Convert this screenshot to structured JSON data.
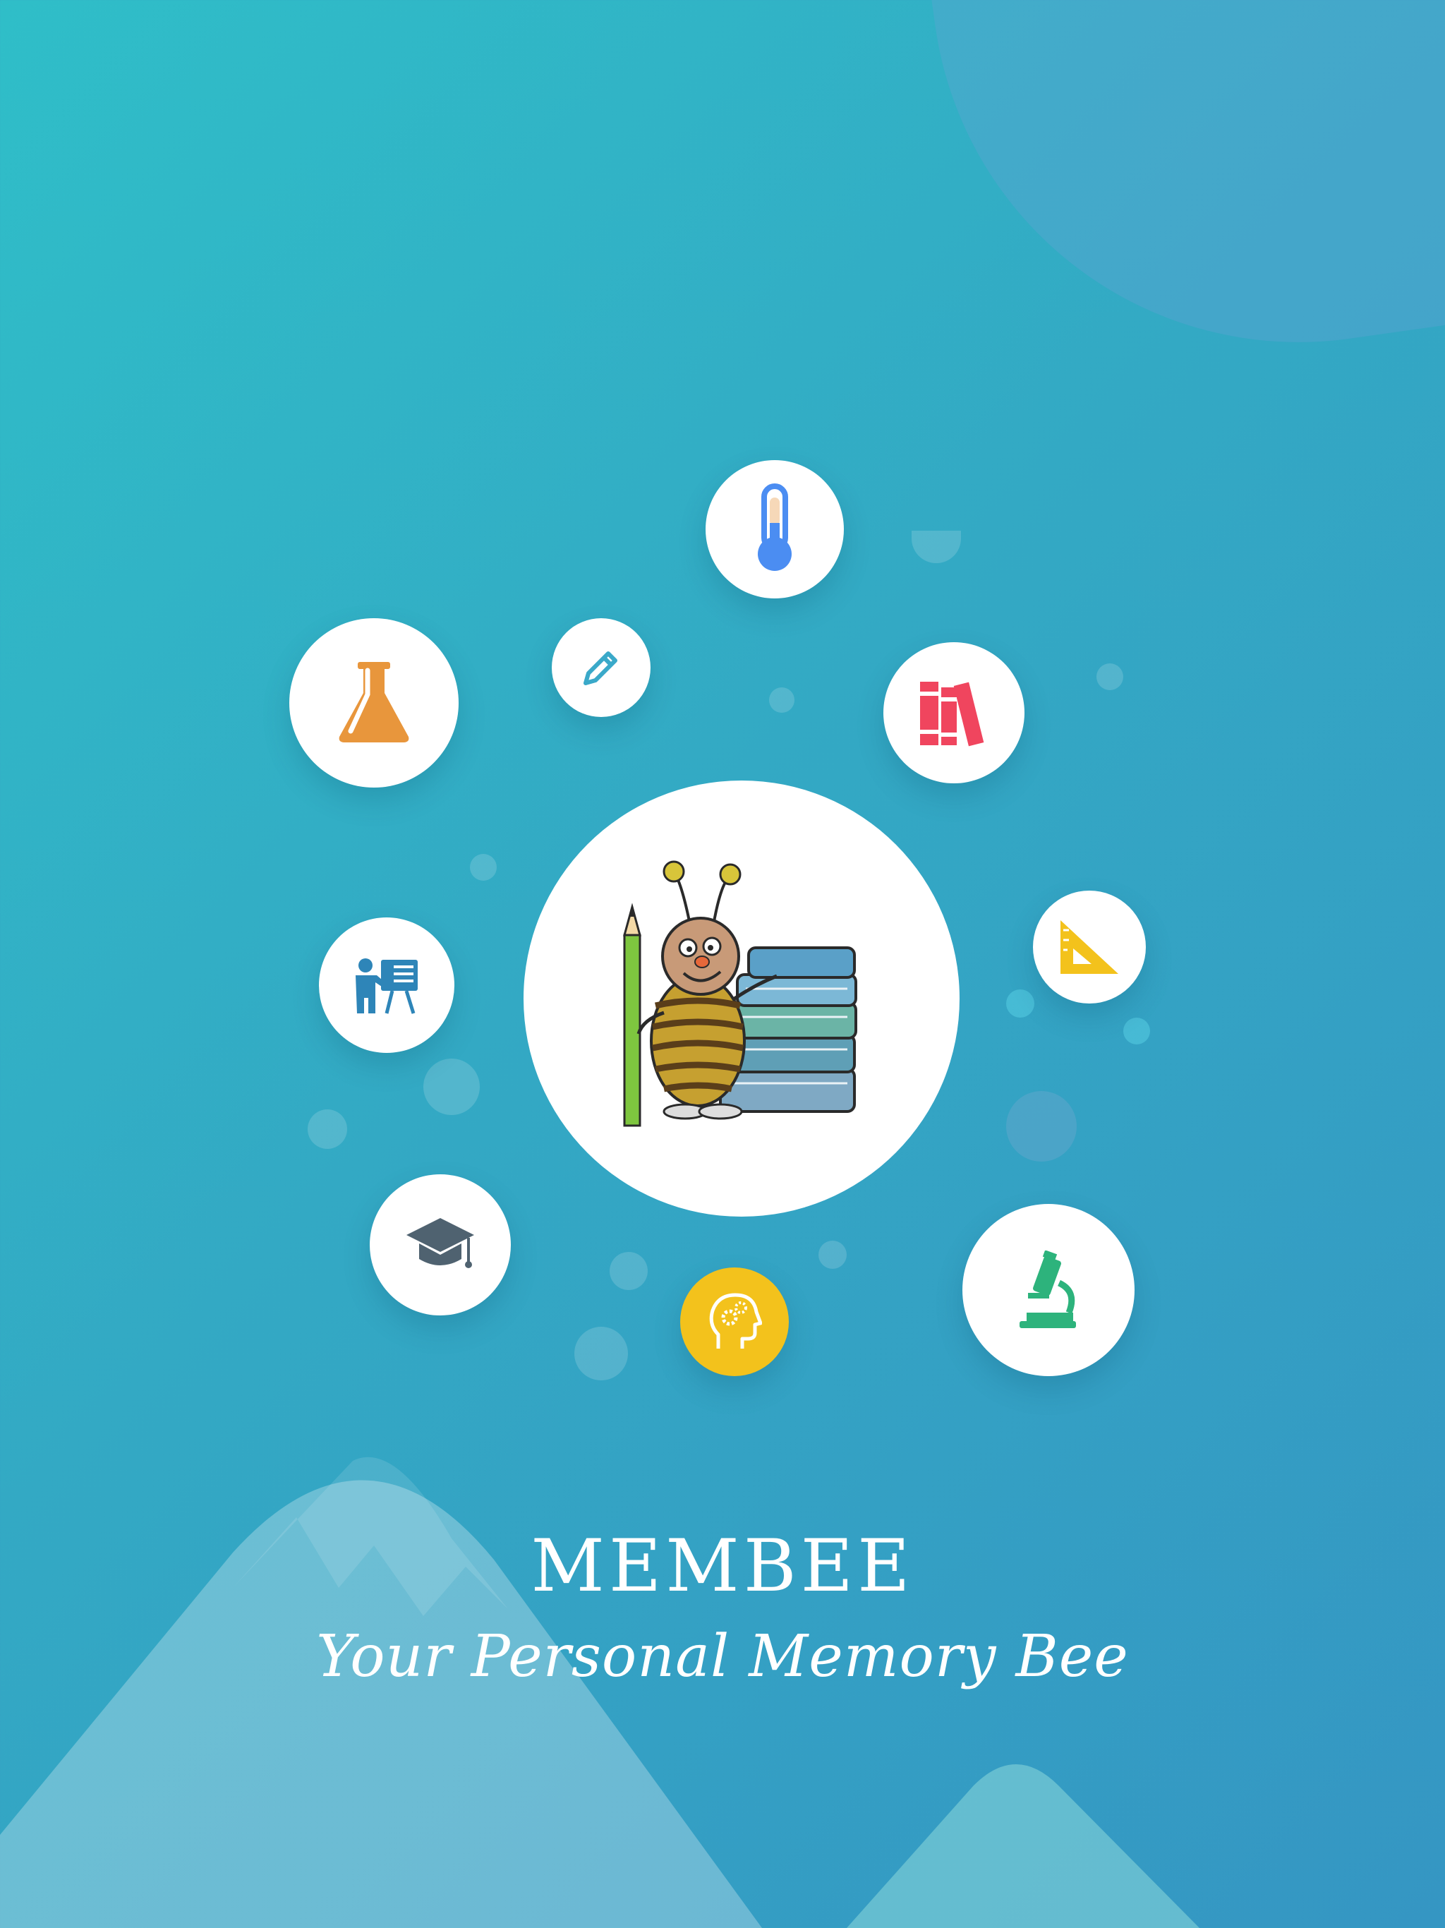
{
  "app": {
    "title": "MEMBEE",
    "tagline": "Your Personal Memory Bee"
  },
  "icons": [
    {
      "name": "thermometer-icon",
      "color": "#4b8df2"
    },
    {
      "name": "pencil-icon",
      "color": "#3aa9c9"
    },
    {
      "name": "flask-icon",
      "color": "#e8963c"
    },
    {
      "name": "books-icon",
      "color": "#f0455e"
    },
    {
      "name": "set-square-icon",
      "color": "#f3c21c"
    },
    {
      "name": "teacher-board-icon",
      "color": "#2e85b8"
    },
    {
      "name": "graduation-cap-icon",
      "color": "#4f6270"
    },
    {
      "name": "brain-gears-icon",
      "color": "#f3c21c"
    },
    {
      "name": "microscope-icon",
      "color": "#2db37c"
    }
  ],
  "colors": {
    "background_start": "#2fbec8",
    "background_end": "#3596c3",
    "text": "#ffffff"
  }
}
